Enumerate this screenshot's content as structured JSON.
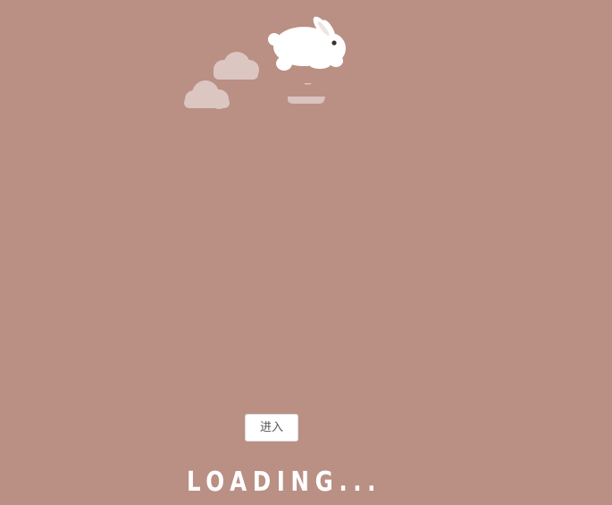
{
  "enter_button": {
    "label": "进入"
  },
  "loading": {
    "text": "LOADING..."
  },
  "colors": {
    "background": "#ba8f84",
    "cloud": "#dcc6c2",
    "rabbit": "#ffffff",
    "button_background": "#ffffff",
    "loading_text": "#ffffff"
  },
  "icons": {
    "mascot": "rabbit-icon",
    "clouds": "cloud-icon"
  }
}
